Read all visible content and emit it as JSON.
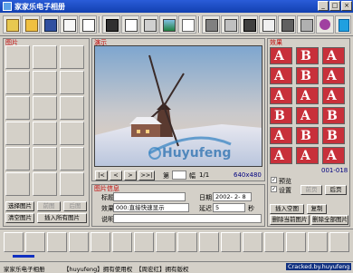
{
  "window": {
    "title": "家家乐电子相册"
  },
  "toolbar": {
    "tools": [
      {
        "name": "new-album-icon"
      },
      {
        "name": "open-folder-icon"
      },
      {
        "name": "save-disk-icon"
      },
      {
        "name": "film-icon"
      },
      {
        "name": "copy-icon"
      },
      {
        "name": "book-icon"
      },
      {
        "name": "page-icon"
      },
      {
        "name": "picture-icon"
      },
      {
        "name": "landscape-icon"
      },
      {
        "name": "document-icon"
      },
      {
        "name": "scroll-icon"
      },
      {
        "name": "menu-icon"
      },
      {
        "name": "filmstrip-icon"
      },
      {
        "name": "brush-icon"
      },
      {
        "name": "camera-icon"
      },
      {
        "name": "magnifier-icon"
      },
      {
        "name": "globe-icon"
      },
      {
        "name": "settings-icon"
      },
      {
        "name": "help-icon"
      },
      {
        "name": "exit-icon"
      }
    ]
  },
  "left": {
    "label": "图片",
    "buttons": {
      "select": "选择图片",
      "prev": "前图",
      "next": "后图",
      "clear": "清空图片",
      "insert_all": "插入所有图片"
    }
  },
  "preview": {
    "label": "演示",
    "nav": {
      "first": "|<",
      "prev": "<",
      "next": ">",
      "last": ">>|"
    },
    "page_label": "第",
    "frame_label": "幅",
    "page": "1/1",
    "size": "640x480"
  },
  "info": {
    "label": "图片信息",
    "title_label": "标题",
    "title_value": "",
    "date_label": "日期",
    "date_value": "2002- 2- 8",
    "effect_label": "效果",
    "effect_value": "000:直接快速显示",
    "delay_label": "延迟",
    "delay_value": "5",
    "delay_unit": "秒",
    "note_label": "说明",
    "note_value": ""
  },
  "effects": {
    "label": "效果",
    "count": "001-018",
    "preview_label": "预览",
    "set_label": "设置",
    "prev_btn": "前页",
    "next_btn": "后页",
    "insert_blank": "插入空图",
    "copy_btn": "复制",
    "delete_current": "删除当前图片",
    "delete_all": "删除全部图片"
  },
  "status": {
    "app": "家家乐电子相册",
    "rights1": "【huyufeng】拥有使用权",
    "rights2": "【周宏红】拥有版权",
    "cracked": "Cracked.by.huyufeng"
  },
  "watermark": "Huyufeng"
}
